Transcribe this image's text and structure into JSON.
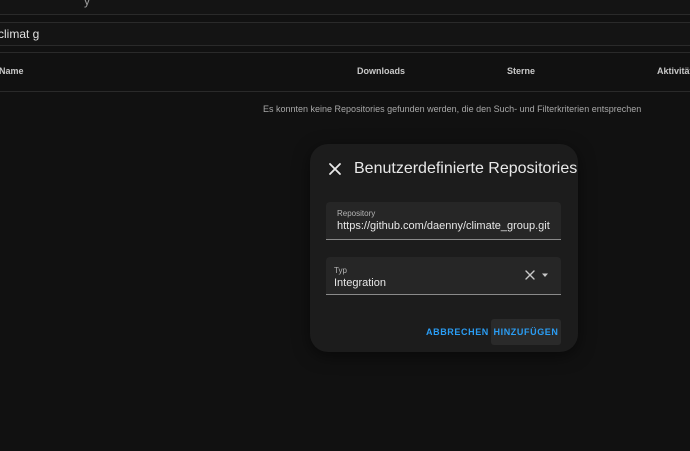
{
  "header": {
    "top_fragment": "y"
  },
  "search": {
    "value": "climat g"
  },
  "table": {
    "columns": [
      "Name",
      "Downloads",
      "Sterne",
      "Aktivität"
    ],
    "empty_message": "Es konnten keine Repositories gefunden werden, die den Such- und Filterkriterien entsprechen"
  },
  "dialog": {
    "title": "Benutzerdefinierte Repositories",
    "repository_field": {
      "label": "Repository",
      "value": "https://github.com/daenny/climate_group.git"
    },
    "type_field": {
      "label": "Typ",
      "value": "Integration"
    },
    "cancel_label": "ABBRECHEN",
    "add_label": "HINZUFÜGEN"
  },
  "colors": {
    "background": "#111111",
    "dialog_background": "#1c1c1c",
    "accent": "#2a9df4"
  },
  "icons": [
    "close-icon",
    "clear-icon",
    "chevron-down-icon"
  ]
}
